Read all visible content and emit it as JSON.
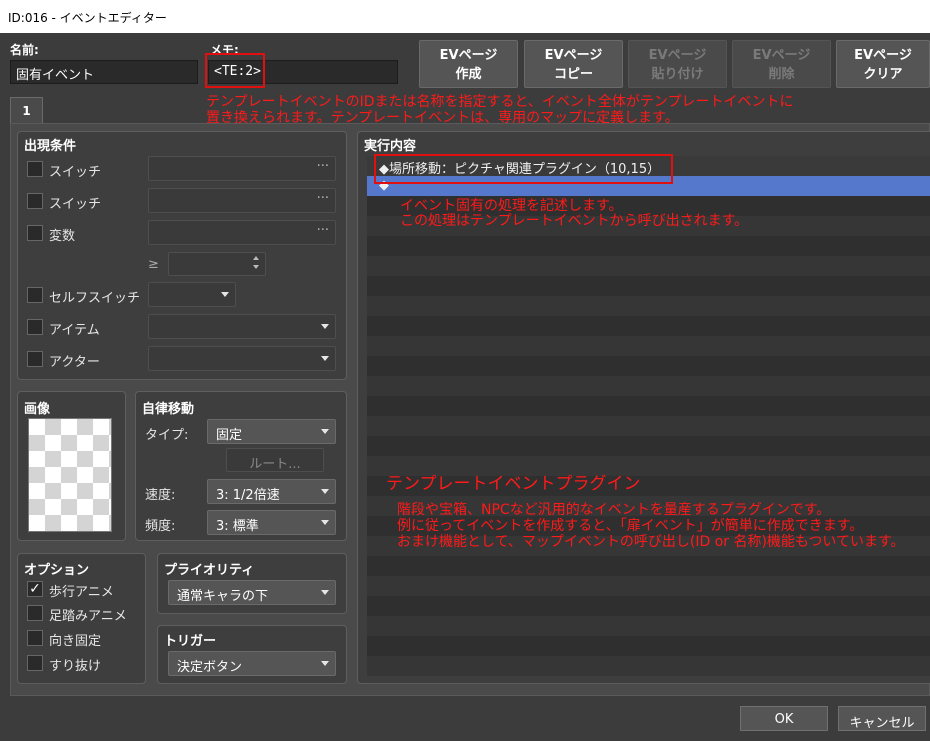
{
  "window": {
    "title": "ID:016 - イベントエディター"
  },
  "header": {
    "name_label": "名前:",
    "name_value": "固有イベント",
    "memo_label": "メモ:",
    "memo_value": "<TE:2>"
  },
  "toolbar": [
    {
      "line1": "EVページ",
      "line2": "作成",
      "enabled": true
    },
    {
      "line1": "EVページ",
      "line2": "コピー",
      "enabled": true
    },
    {
      "line1": "EVページ",
      "line2": "貼り付け",
      "enabled": false
    },
    {
      "line1": "EVページ",
      "line2": "削除",
      "enabled": false
    },
    {
      "line1": "EVページ",
      "line2": "クリア",
      "enabled": true
    }
  ],
  "annotation_top": {
    "line1": "テンプレートイベントのIDまたは名称を指定すると、イベント全体がテンプレートイベントに",
    "line2": "置き換えられます。テンプレートイベントは、専用のマップに定義します。"
  },
  "page_tab": {
    "label": "1"
  },
  "conditions": {
    "title": "出現条件",
    "switch1": "スイッチ",
    "switch2": "スイッチ",
    "variable": "変数",
    "ge": "≥",
    "self_switch": "セルフスイッチ",
    "item": "アイテム",
    "actor": "アクター",
    "dots": "···"
  },
  "image": {
    "title": "画像"
  },
  "movement": {
    "title": "自律移動",
    "type_label": "タイプ:",
    "type_value": "固定",
    "route_button": "ルート...",
    "speed_label": "速度:",
    "speed_value": "3: 1/2倍速",
    "freq_label": "頻度:",
    "freq_value": "3: 標準"
  },
  "options": {
    "title": "オプション",
    "walking": "歩行アニメ",
    "walking_checked": true,
    "stepping": "足踏みアニメ",
    "direction_fix": "向き固定",
    "through": "すり抜け",
    "check_mark": "✓"
  },
  "priority": {
    "title": "プライオリティ",
    "value": "通常キャラの下"
  },
  "trigger": {
    "title": "トリガー",
    "value": "決定ボタン"
  },
  "contents": {
    "title": "実行内容",
    "command_line": "◆場所移動：ピクチャ関連プラグイン（10,15）",
    "empty_marker": "◆"
  },
  "annotation_mid": {
    "line1": "イベント固有の処理を記述します。",
    "line2": "この処理はテンプレートイベントから呼び出されます。"
  },
  "annotation_bottom": {
    "title": "テンプレートイベントプラグイン",
    "line1": "階段や宝箱、NPCなど汎用的なイベントを量産するプラグインです。",
    "line2": "例に従ってイベントを作成すると、「扉イベント」が簡単に作成できます。",
    "line3": "おまけ機能として、マップイベントの呼び出し(ID or 名称)機能もついています。"
  },
  "footer": {
    "ok": "OK",
    "cancel": "キャンセル"
  },
  "colors": {
    "annotation": "#ff1a1a",
    "selected_row": "#5577cc",
    "background": "#3c3c3c"
  }
}
